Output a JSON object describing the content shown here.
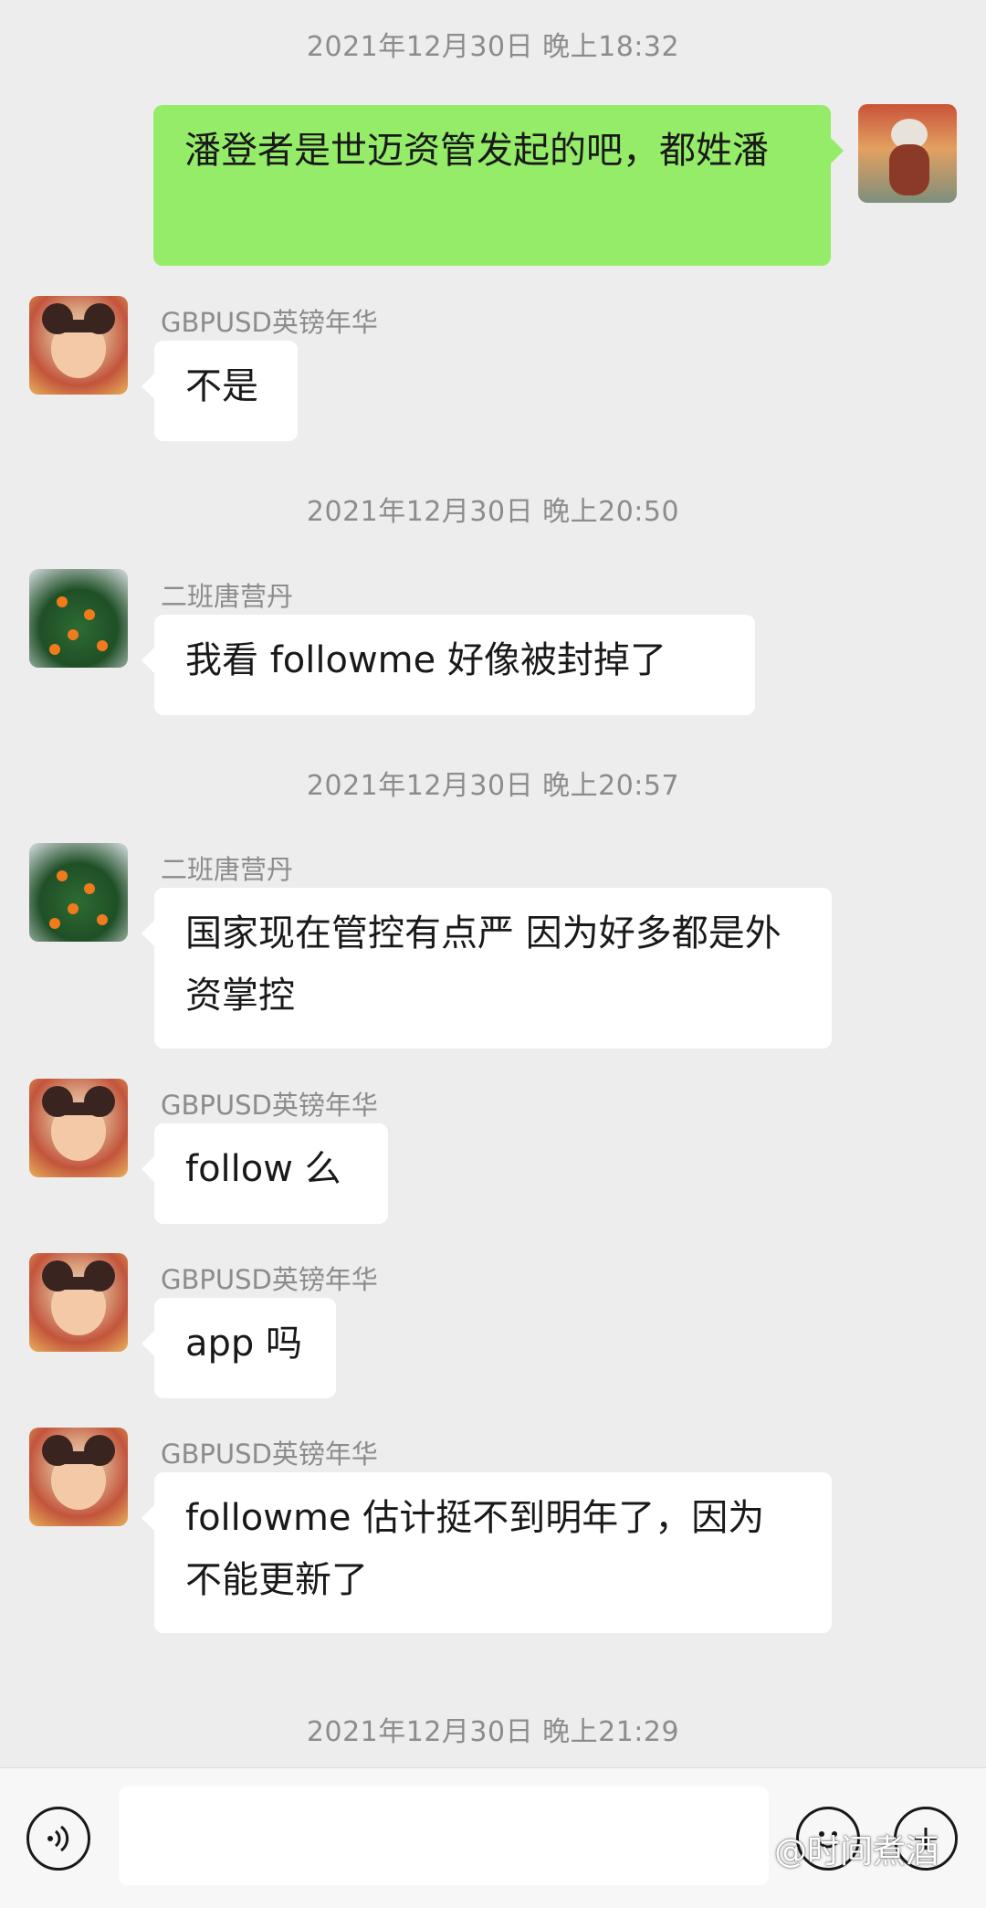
{
  "timestamps": [
    "2021年12月30日 晚上18:32",
    "2021年12月30日 晚上20:50",
    "2021年12月30日 晚上20:57",
    "2021年12月30日 晚上21:29"
  ],
  "senders": {
    "gbp": "GBPUSD英镑年华",
    "tang": "二班唐营丹"
  },
  "messages": [
    {
      "from": "me",
      "text": "潘登者是世迈资管发起的吧，都姓潘"
    },
    {
      "from": "gbp",
      "text": "不是"
    },
    {
      "from": "tang",
      "text": "我看 followme 好像被封掉了"
    },
    {
      "from": "tang",
      "text": "国家现在管控有点严  因为好多都是外资掌控"
    },
    {
      "from": "gbp",
      "text": "follow 么"
    },
    {
      "from": "gbp",
      "text": "app 吗"
    },
    {
      "from": "gbp",
      "text": "followme 估计挺不到明年了，因为不能更新了"
    }
  ],
  "input_bar": {
    "icons": [
      "voice-icon",
      "emoji-icon",
      "plus-icon"
    ]
  },
  "watermark": "@时间煮酒",
  "colors": {
    "background": "#ededed",
    "my_bubble": "#95ec69",
    "other_bubble": "#ffffff",
    "meta_text": "#8c8c8c"
  }
}
